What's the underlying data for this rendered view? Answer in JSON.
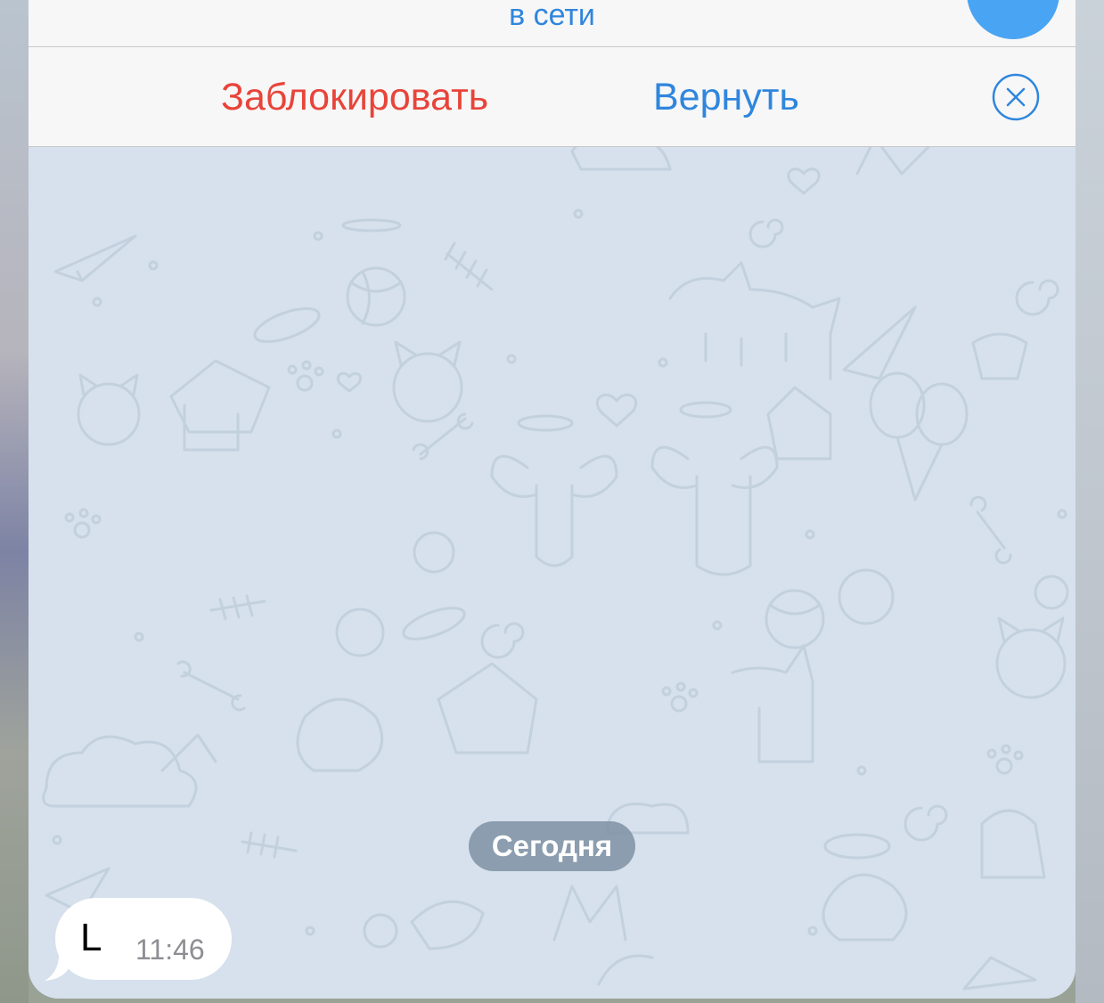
{
  "header": {
    "status": "в сети"
  },
  "actions": {
    "block_label": "Заблокировать",
    "return_label": "Вернуть",
    "close_icon": "close-circle-icon"
  },
  "chat": {
    "date_label": "Сегодня",
    "messages": [
      {
        "text": "L",
        "time": "11:46",
        "direction": "incoming"
      }
    ]
  },
  "colors": {
    "accent": "#2f86dd",
    "destructive": "#e8443a",
    "chat_background": "#d6e1ed",
    "avatar": "#4aa4f4"
  }
}
